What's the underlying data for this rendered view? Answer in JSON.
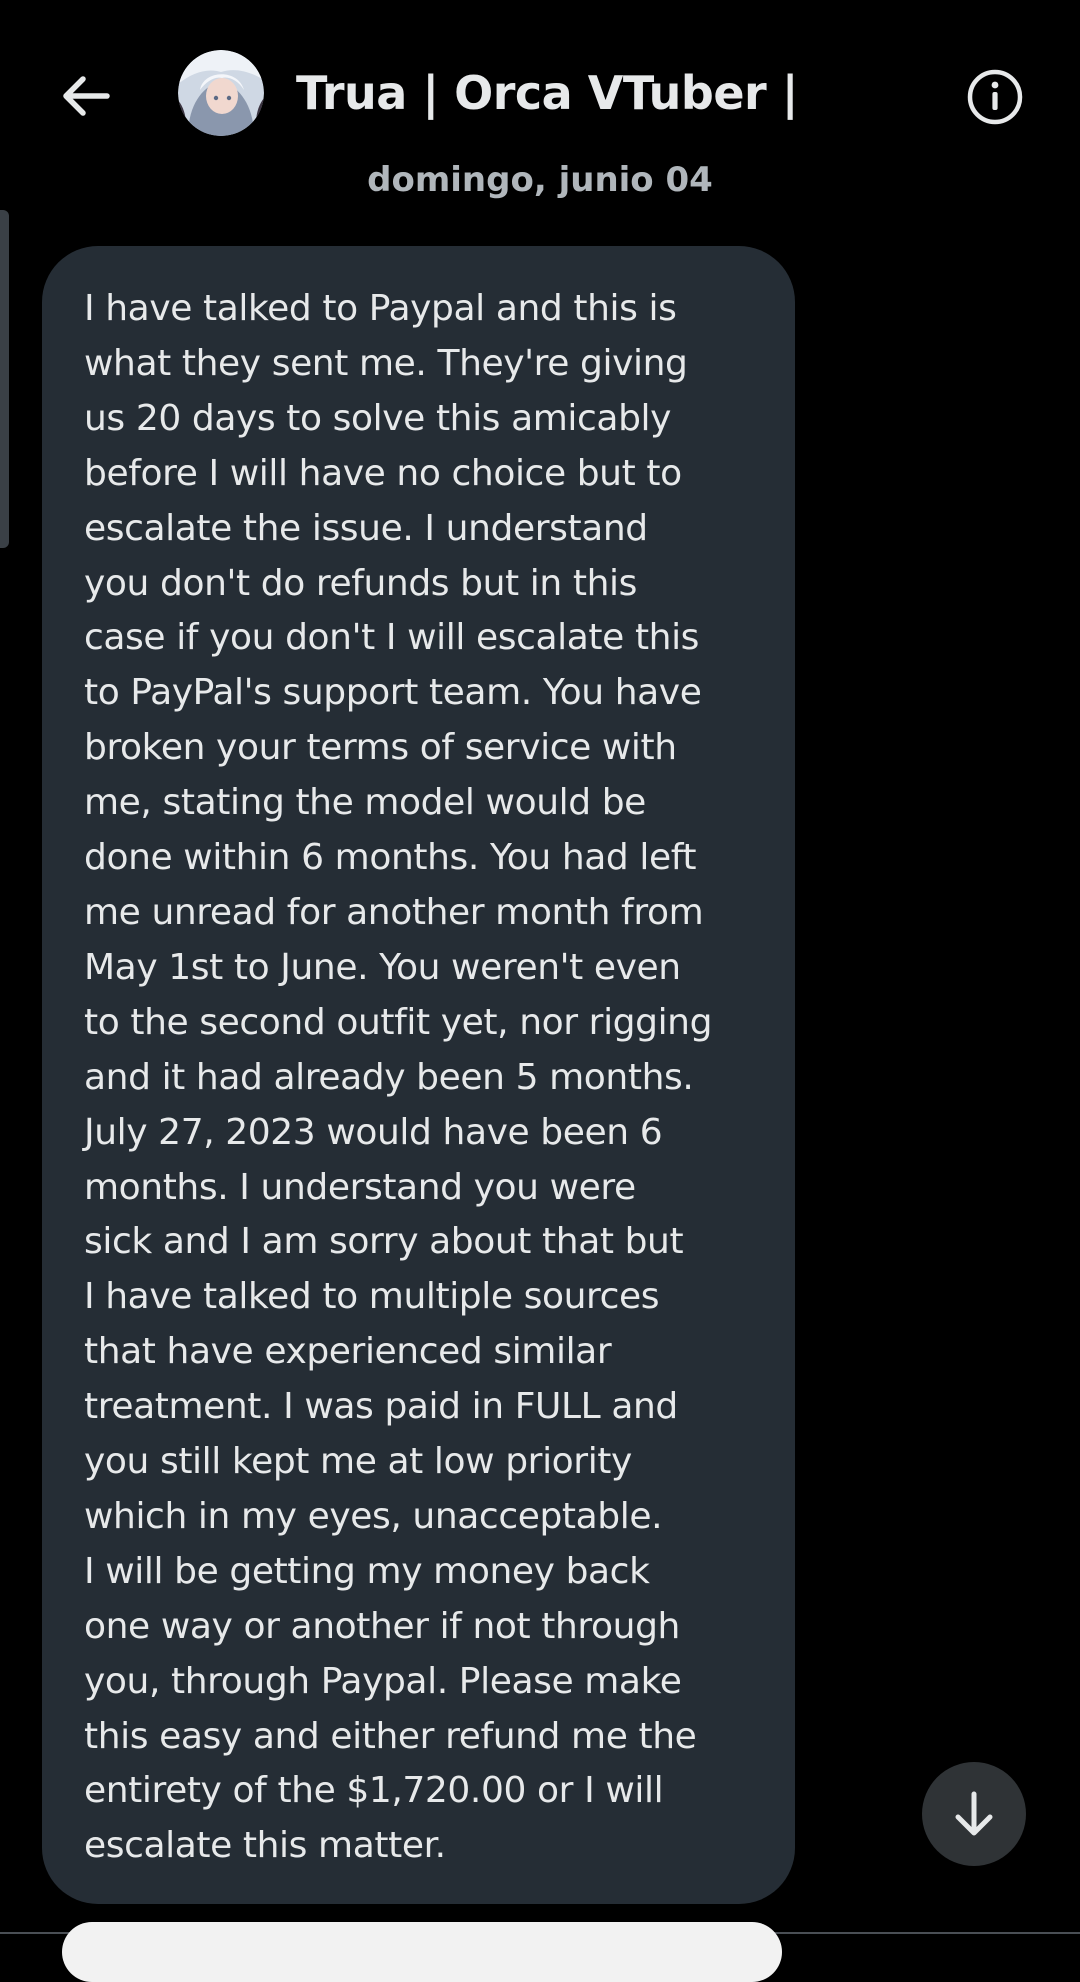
{
  "header": {
    "title": "Trua | Orca VTuber |",
    "back_icon": "arrow-left-icon",
    "info_icon": "info-icon"
  },
  "conversation": {
    "date_separator": "domingo, junio 04",
    "message": {
      "text": "I have talked to Paypal and this is\nwhat they sent me. They're giving\nus 20 days to solve this amicably\nbefore I will have no choice but to\nescalate the issue. I understand\nyou don't do refunds but in this\ncase if you don't I will escalate this\nto PayPal's support team. You have\nbroken your terms of service with\nme, stating the model would be\ndone within 6 months. You had left\nme unread for another month from\nMay 1st to June. You weren't even\nto the second outfit yet, nor rigging\nand it had already been 5 months.\nJuly 27, 2023 would have been 6\nmonths. I understand you were\nsick and I am sorry about that but\nI have talked to multiple sources\nthat have experienced similar\ntreatment. I was paid in FULL and\nyou still kept me at low priority\nwhich in my eyes, unacceptable.\nI will be getting my money back\none way or another if not through\nyou, through Paypal. Please make\nthis easy and either refund me the\nentirety of the $1,720.00 or I will\nescalate this matter."
    }
  },
  "controls": {
    "scroll_down_icon": "arrow-down-icon"
  },
  "colors": {
    "background": "#000000",
    "bubble": "#252d35",
    "text": "#e7e9ea",
    "muted_text": "#b0b6bb",
    "fab": "#2f3336"
  }
}
